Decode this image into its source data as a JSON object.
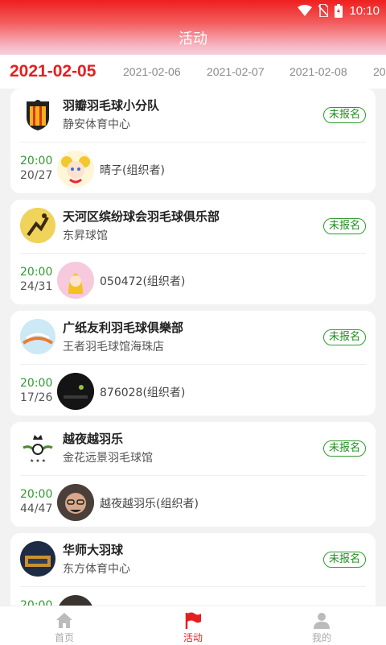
{
  "status": {
    "time": "10:10"
  },
  "header": {
    "title": "活动"
  },
  "dates": [
    "2021-02-05",
    "2021-02-06",
    "2021-02-07",
    "2021-02-08",
    "20"
  ],
  "activities": [
    {
      "club": "羽瓣羽毛球小分队",
      "venue": "静安体育中心",
      "status": "未报名",
      "time": "20:00",
      "count": "20/27",
      "organizer": "晴子(组织者)"
    },
    {
      "club": "天河区缤纷球会羽毛球俱乐部",
      "venue": "东昇球馆",
      "status": "未报名",
      "time": "20:00",
      "count": "24/31",
      "organizer": "050472(组织者)"
    },
    {
      "club": "广纸友利羽毛球俱樂部",
      "venue": "王者羽毛球馆海珠店",
      "status": "未报名",
      "time": "20:00",
      "count": "17/26",
      "organizer": "876028(组织者)"
    },
    {
      "club": "越夜越羽乐",
      "venue": "金花远景羽毛球馆",
      "status": "未报名",
      "time": "20:00",
      "count": "44/47",
      "organizer": "越夜越羽乐(组织者)"
    },
    {
      "club": "华师大羽球",
      "venue": "东方体育中心",
      "status": "未报名",
      "time": "20:00",
      "count": "",
      "organizer": ""
    }
  ],
  "nav": {
    "home": "首页",
    "activity": "活动",
    "mine": "我的"
  },
  "colors": {
    "accent": "#e51f1f",
    "green": "#2e9b2e"
  }
}
